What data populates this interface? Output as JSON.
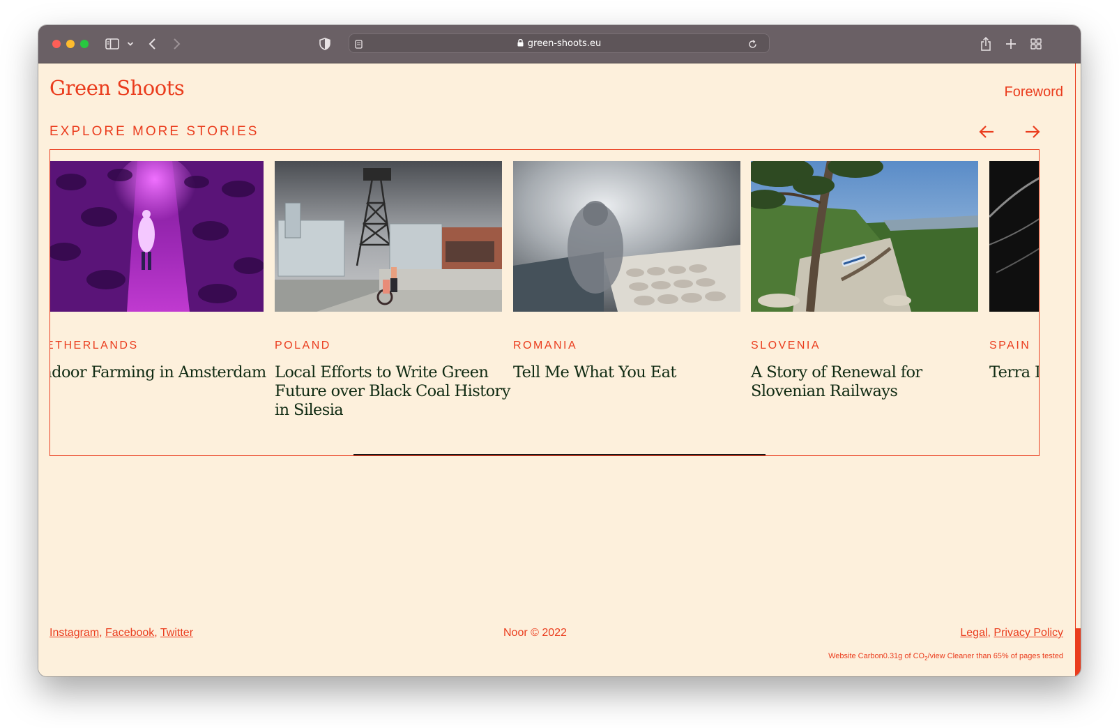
{
  "browser": {
    "url": "green-shoots.eu",
    "colors": {
      "chrome": "#6a6065",
      "traffic_red": "#fe5f57",
      "traffic_yellow": "#febc2e",
      "traffic_green": "#28c840"
    },
    "icons": [
      "sidebar-icon",
      "chevron-down-icon",
      "back-icon",
      "forward-icon",
      "shield-icon",
      "page-icon",
      "lock-icon",
      "reload-icon",
      "share-icon",
      "plus-icon",
      "tab-overview-icon"
    ]
  },
  "site": {
    "logo": "Green Shoots",
    "nav_link": "Foreword",
    "accent_color": "#ea3c1d",
    "background_color": "#fdf0dc",
    "title_color": "#0f2a12"
  },
  "stories": {
    "heading": "EXPLORE MORE STORIES",
    "progress_fraction": 0.42,
    "cards": [
      {
        "country": "NETHERLANDS",
        "title": "Indoor Farming in Amsterdam"
      },
      {
        "country": "POLAND",
        "title": "Local Efforts to Write Green Future over Black Coal History in Silesia"
      },
      {
        "country": "ROMANIA",
        "title": "Tell Me What You Eat"
      },
      {
        "country": "SLOVENIA",
        "title": "A Story of Renewal for Slovenian Railways"
      },
      {
        "country": "SPAIN",
        "title": "Terra L"
      }
    ]
  },
  "footer": {
    "social": [
      "Instagram",
      "Facebook",
      "Twitter"
    ],
    "copyright": "Noor © 2022",
    "legal": [
      "Legal",
      "Privacy Policy"
    ],
    "carbon_pre": "Website Carbon0.31g of CO",
    "carbon_sub": "2",
    "carbon_post": "/view Cleaner than 65% of pages tested"
  }
}
